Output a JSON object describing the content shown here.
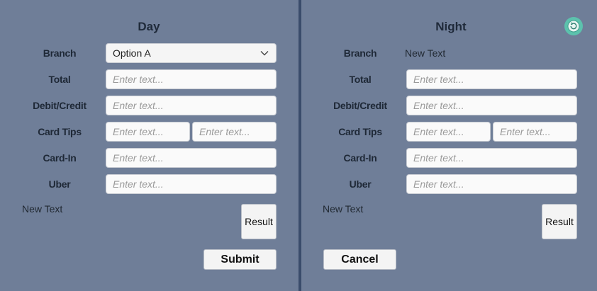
{
  "day": {
    "title": "Day",
    "labels": {
      "branch": "Branch",
      "total": "Total",
      "debit_credit": "Debit/Credit",
      "card_tips": "Card Tips",
      "card_in": "Card-In",
      "uber": "Uber"
    },
    "branch_select": {
      "value": "Option A"
    },
    "placeholders": {
      "total": "Enter text...",
      "debit_credit": "Enter text...",
      "card_tips_1": "Enter text...",
      "card_tips_2": "Enter text...",
      "card_in": "Enter text...",
      "uber": "Enter text..."
    },
    "status_text": "New Text",
    "result_button": "Result",
    "submit_button": "Submit"
  },
  "night": {
    "title": "Night",
    "labels": {
      "branch": "Branch",
      "total": "Total",
      "debit_credit": "Debit/Credit",
      "card_tips": "Card Tips",
      "card_in": "Card-In",
      "uber": "Uber"
    },
    "branch_value": "New Text",
    "placeholders": {
      "total": "Enter text...",
      "debit_credit": "Enter text...",
      "card_tips_1": "Enter text...",
      "card_tips_2": "Enter text...",
      "card_in": "Enter text...",
      "uber": "Enter text..."
    },
    "status_text": "New Text",
    "result_button": "Result",
    "cancel_button": "Cancel"
  },
  "icons": {
    "refresh": "refresh-icon",
    "dropdown": "chevron-down-icon"
  },
  "colors": {
    "background": "#6f7e98",
    "divider": "#3a4c6b",
    "refresh_accent": "#5cc2ad"
  }
}
